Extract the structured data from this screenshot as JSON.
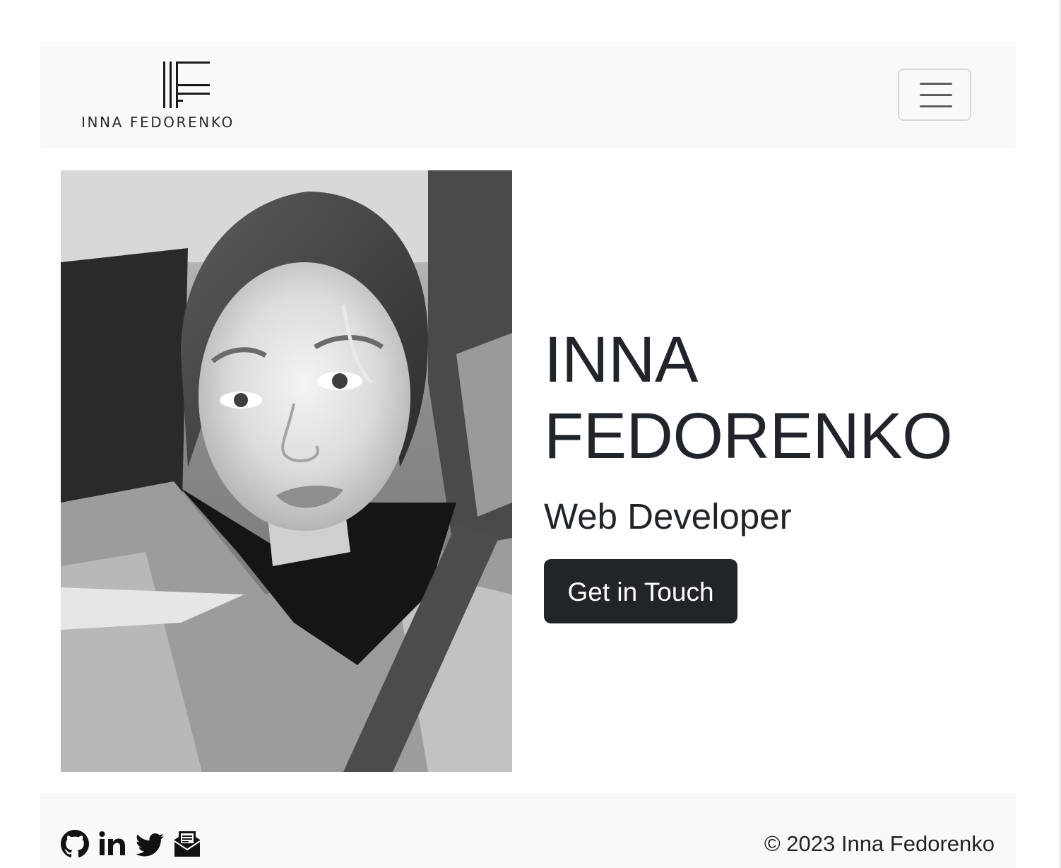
{
  "navbar": {
    "brand": {
      "monogram": "IF",
      "text": "INNA FEDORENKO"
    },
    "toggler_icon": "hamburger-menu-icon"
  },
  "hero": {
    "photo_alt": "Inna Fedorenko",
    "name": "INNA FEDORENKO",
    "subtitle": "Web Developer",
    "cta_label": "Get in Touch"
  },
  "footer": {
    "social_icons": [
      "github-icon",
      "linkedin-icon",
      "twitter-icon",
      "email-icon"
    ],
    "copyright": "© 2023 Inna Fedorenko"
  },
  "colors": {
    "navbar_bg": "#f8f9fa",
    "text": "#212529",
    "button_bg": "#212529",
    "button_text": "#ffffff"
  }
}
